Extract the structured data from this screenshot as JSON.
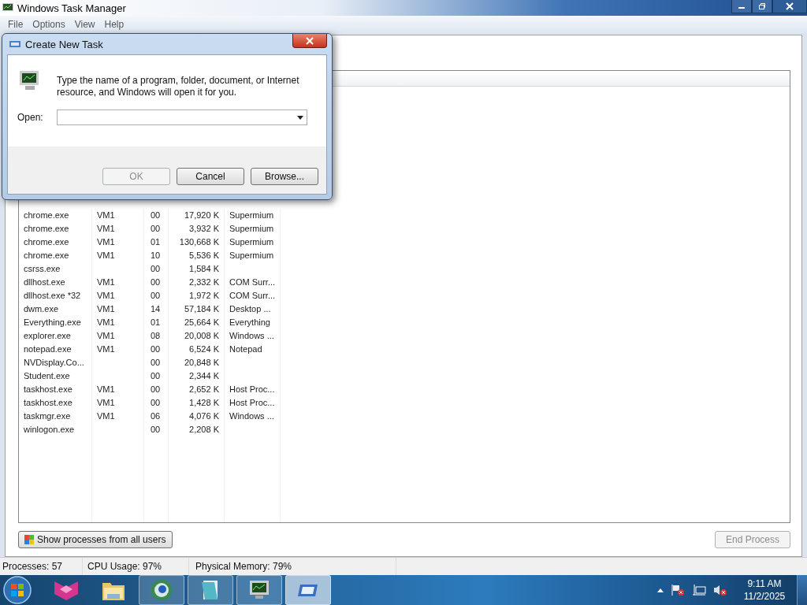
{
  "window": {
    "title": "Windows Task Manager"
  },
  "menu": [
    "File",
    "Options",
    "View",
    "Help"
  ],
  "processes": [
    {
      "name": "chrome.exe",
      "user": "VM1",
      "cpu": "00",
      "memory": "17,920 K",
      "description": "Supermium"
    },
    {
      "name": "chrome.exe",
      "user": "VM1",
      "cpu": "00",
      "memory": "3,932 K",
      "description": "Supermium"
    },
    {
      "name": "chrome.exe",
      "user": "VM1",
      "cpu": "01",
      "memory": "130,668 K",
      "description": "Supermium"
    },
    {
      "name": "chrome.exe",
      "user": "VM1",
      "cpu": "10",
      "memory": "5,536 K",
      "description": "Supermium"
    },
    {
      "name": "csrss.exe",
      "cpu": "00",
      "memory": "1,584 K"
    },
    {
      "name": "dllhost.exe",
      "user": "VM1",
      "cpu": "00",
      "memory": "2,332 K",
      "description": "COM Surr..."
    },
    {
      "name": "dllhost.exe *32",
      "user": "VM1",
      "cpu": "00",
      "memory": "1,972 K",
      "description": "COM Surr..."
    },
    {
      "name": "dwm.exe",
      "user": "VM1",
      "cpu": "14",
      "memory": "57,184 K",
      "description": "Desktop ..."
    },
    {
      "name": "Everything.exe",
      "user": "VM1",
      "cpu": "01",
      "memory": "25,664 K",
      "description": "Everything"
    },
    {
      "name": "explorer.exe",
      "user": "VM1",
      "cpu": "08",
      "memory": "20,008 K",
      "description": "Windows ..."
    },
    {
      "name": "notepad.exe",
      "user": "VM1",
      "cpu": "00",
      "memory": "6,524 K",
      "description": "Notepad"
    },
    {
      "name": "NVDisplay.Co...",
      "cpu": "00",
      "memory": "20,848 K"
    },
    {
      "name": "Student.exe",
      "cpu": "00",
      "memory": "2,344 K"
    },
    {
      "name": "taskhost.exe",
      "user": "VM1",
      "cpu": "00",
      "memory": "2,652 K",
      "description": "Host Proc..."
    },
    {
      "name": "taskhost.exe",
      "user": "VM1",
      "cpu": "00",
      "memory": "1,428 K",
      "description": "Host Proc..."
    },
    {
      "name": "taskmgr.exe",
      "user": "VM1",
      "cpu": "06",
      "memory": "4,076 K",
      "description": "Windows ..."
    },
    {
      "name": "winlogon.exe",
      "cpu": "00",
      "memory": "2,208 K"
    }
  ],
  "show_all_button": {
    "label": "Show processes from all users",
    "disabled": false
  },
  "end_process_button": {
    "label": "End Process",
    "disabled": true
  },
  "status_bar": [
    "Processes: 57",
    "CPU Usage: 97%",
    "Physical Memory: 79%"
  ],
  "dialog": {
    "title": "Create New Task",
    "message": "Type the name of a program, folder, document, or Internet resource, and Windows will open it for you.",
    "open_label": "Open:",
    "buttons": [
      {
        "label": "OK",
        "disabled": true
      },
      {
        "label": "Cancel",
        "disabled": false
      },
      {
        "label": "Browse...",
        "disabled": false
      }
    ]
  },
  "taskbar": {
    "time": "9:11 AM",
    "date": "11/2/2025"
  }
}
